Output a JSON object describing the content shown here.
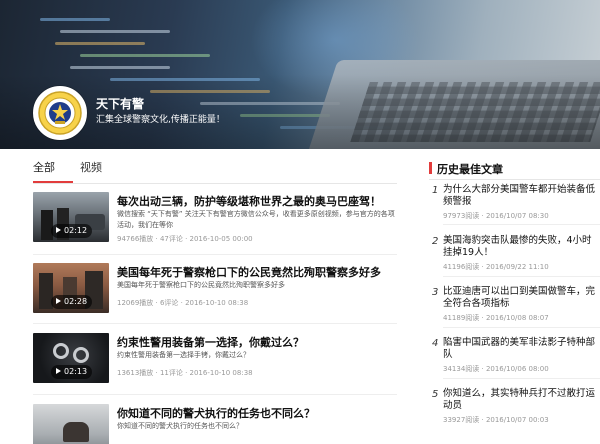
{
  "channel": {
    "name": "天下有警",
    "slogan": "汇集全球警察文化,传播正能量！",
    "logo_icon": "police-badge-icon"
  },
  "tabs": [
    {
      "label": "全部",
      "active": true
    },
    {
      "label": "视频",
      "active": false
    }
  ],
  "articles": [
    {
      "title": "每次出动三辆，防护等级堪称世界之最的奥马巴座驾！",
      "desc": "微信搜索 “天下有警” 关注天下有警官方微信公众号，收看更多原创视频，参与官方的各项活动，我们在等你",
      "meta": "94766播放 · 47评论 · 2016-10-05 00:00",
      "duration": "02:12"
    },
    {
      "title": "美国每年死于警察枪口下的公民竟然比殉职警察多好多",
      "desc": "美国每年死于警察枪口下的公民竟然比殉职警察多好多",
      "meta": "12069播放 · 6评论 · 2016-10-10 08:38",
      "duration": "02:28"
    },
    {
      "title": "约束性警用装备第一选择，你戴过么？",
      "desc": "约束性警用装备第一选择手铐，你戴过么？",
      "meta": "13613播放 · 11评论 · 2016-10-10 08:38",
      "duration": "02:13"
    },
    {
      "title": "你知道不同的警犬执行的任务也不同么？",
      "desc": "你知道不同的警犬执行的任务也不同么？",
      "meta": "",
      "duration": ""
    }
  ],
  "sidebar": {
    "heading": "历史最佳文章",
    "items": [
      {
        "num": "1",
        "title": "为什么大部分美国警车都开始装备低频警报",
        "meta": "97973阅读 · 2016/10/07 08:30"
      },
      {
        "num": "2",
        "title": "美国海豹突击队最惨的失败，4小时挂掉19人！",
        "meta": "41196阅读 · 2016/09/22 11:10"
      },
      {
        "num": "3",
        "title": "比亚迪唐可以出口到美国做警车，完全符合各项指标",
        "meta": "41189阅读 · 2016/10/08 08:07"
      },
      {
        "num": "4",
        "title": "陷害中国武器的美军非法影子特种部队",
        "meta": "34134阅读 · 2016/10/06 08:00"
      },
      {
        "num": "5",
        "title": "你知道么，其实特种兵打不过散打运动员",
        "meta": "33927阅读 · 2016/10/07 00:03"
      }
    ]
  },
  "colors": {
    "accent": "#e23c3c",
    "meta": "#999999"
  }
}
